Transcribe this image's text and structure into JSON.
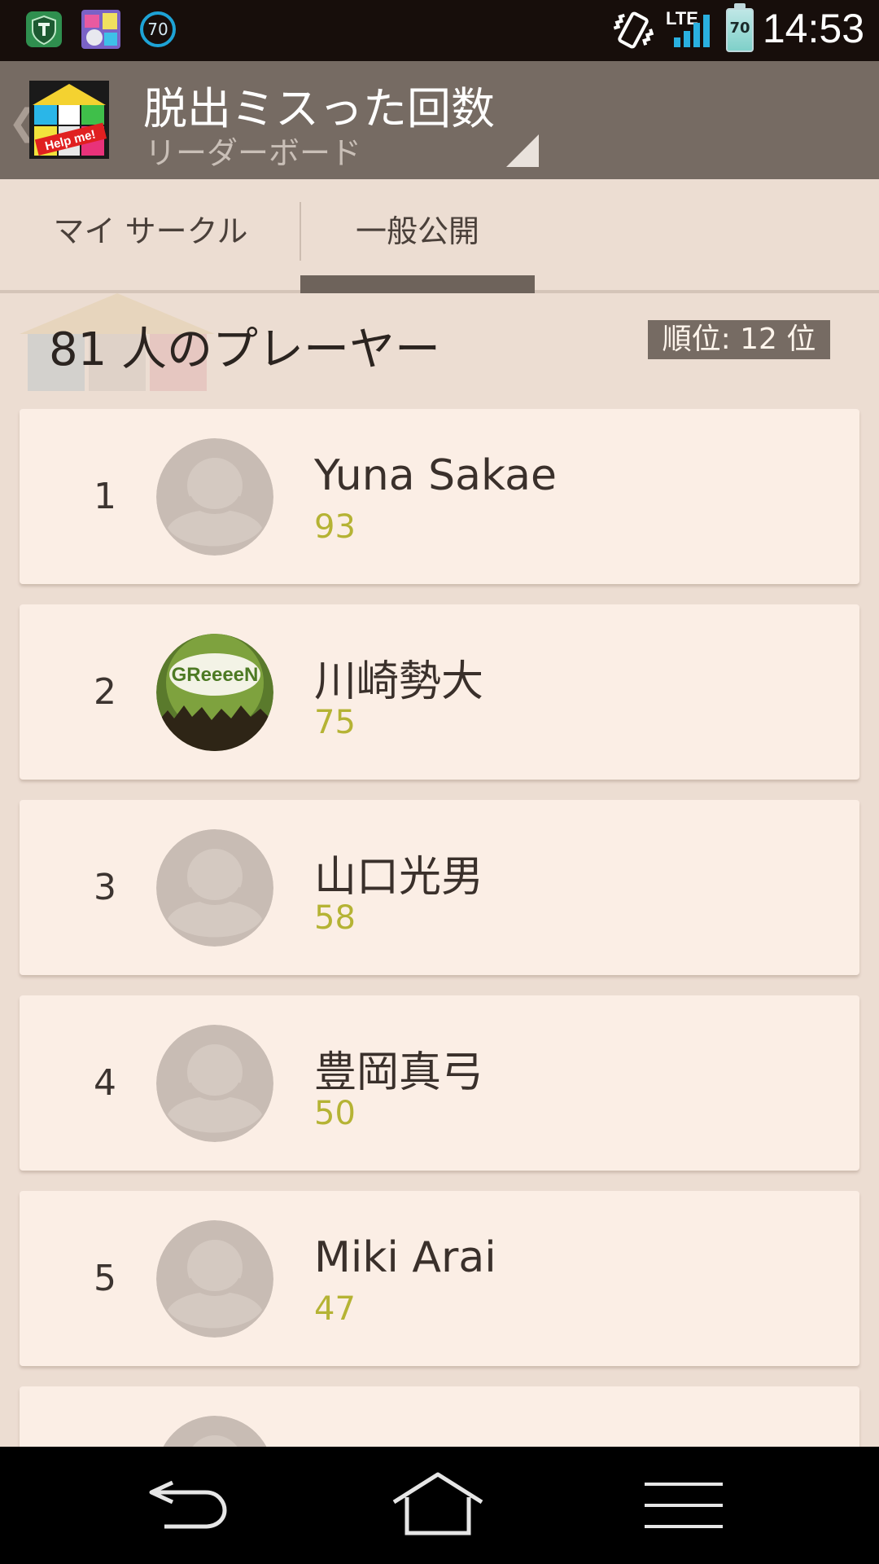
{
  "status_bar": {
    "time": "14:53",
    "network": "LTE",
    "battery": "70",
    "notification_badge": "70",
    "icons": [
      "shield-t-app-icon",
      "game-app-icon",
      "speed-70-icon",
      "vibrate-icon",
      "signal-icon",
      "battery-icon"
    ]
  },
  "action_bar": {
    "title": "脱出ミスった回数",
    "subtitle": "リーダーボード",
    "app_icon_text": "Help me!"
  },
  "tabs": [
    {
      "label": "マイ サークル",
      "selected": false
    },
    {
      "label": "一般公開",
      "selected": true
    }
  ],
  "header": {
    "player_count": "81 人のプレーヤー",
    "rank": "順位: 12 位"
  },
  "leaderboard": [
    {
      "rank": "1",
      "name": "Yuna Sakae",
      "score": "93",
      "avatar": "default-avatar-icon"
    },
    {
      "rank": "2",
      "name": "川崎勢大",
      "score": "75",
      "avatar": "greeeen-photo-avatar"
    },
    {
      "rank": "3",
      "name": "山口光男",
      "score": "58",
      "avatar": "default-avatar-icon"
    },
    {
      "rank": "4",
      "name": "豊岡真弓",
      "score": "50",
      "avatar": "default-avatar-icon"
    },
    {
      "rank": "5",
      "name": "Miki Arai",
      "score": "47",
      "avatar": "default-avatar-icon"
    },
    {
      "rank": "",
      "name": "",
      "score": "",
      "avatar": "default-avatar-icon"
    }
  ],
  "colors": {
    "status_bar": "#170e0b",
    "action_bar": "#766b63",
    "background": "#ecddd2",
    "card": "#fbeee5",
    "score": "#b5b334",
    "nav_bar": "#000000"
  },
  "nav": {
    "icons": [
      "back-icon",
      "home-icon",
      "menu-icon"
    ]
  }
}
